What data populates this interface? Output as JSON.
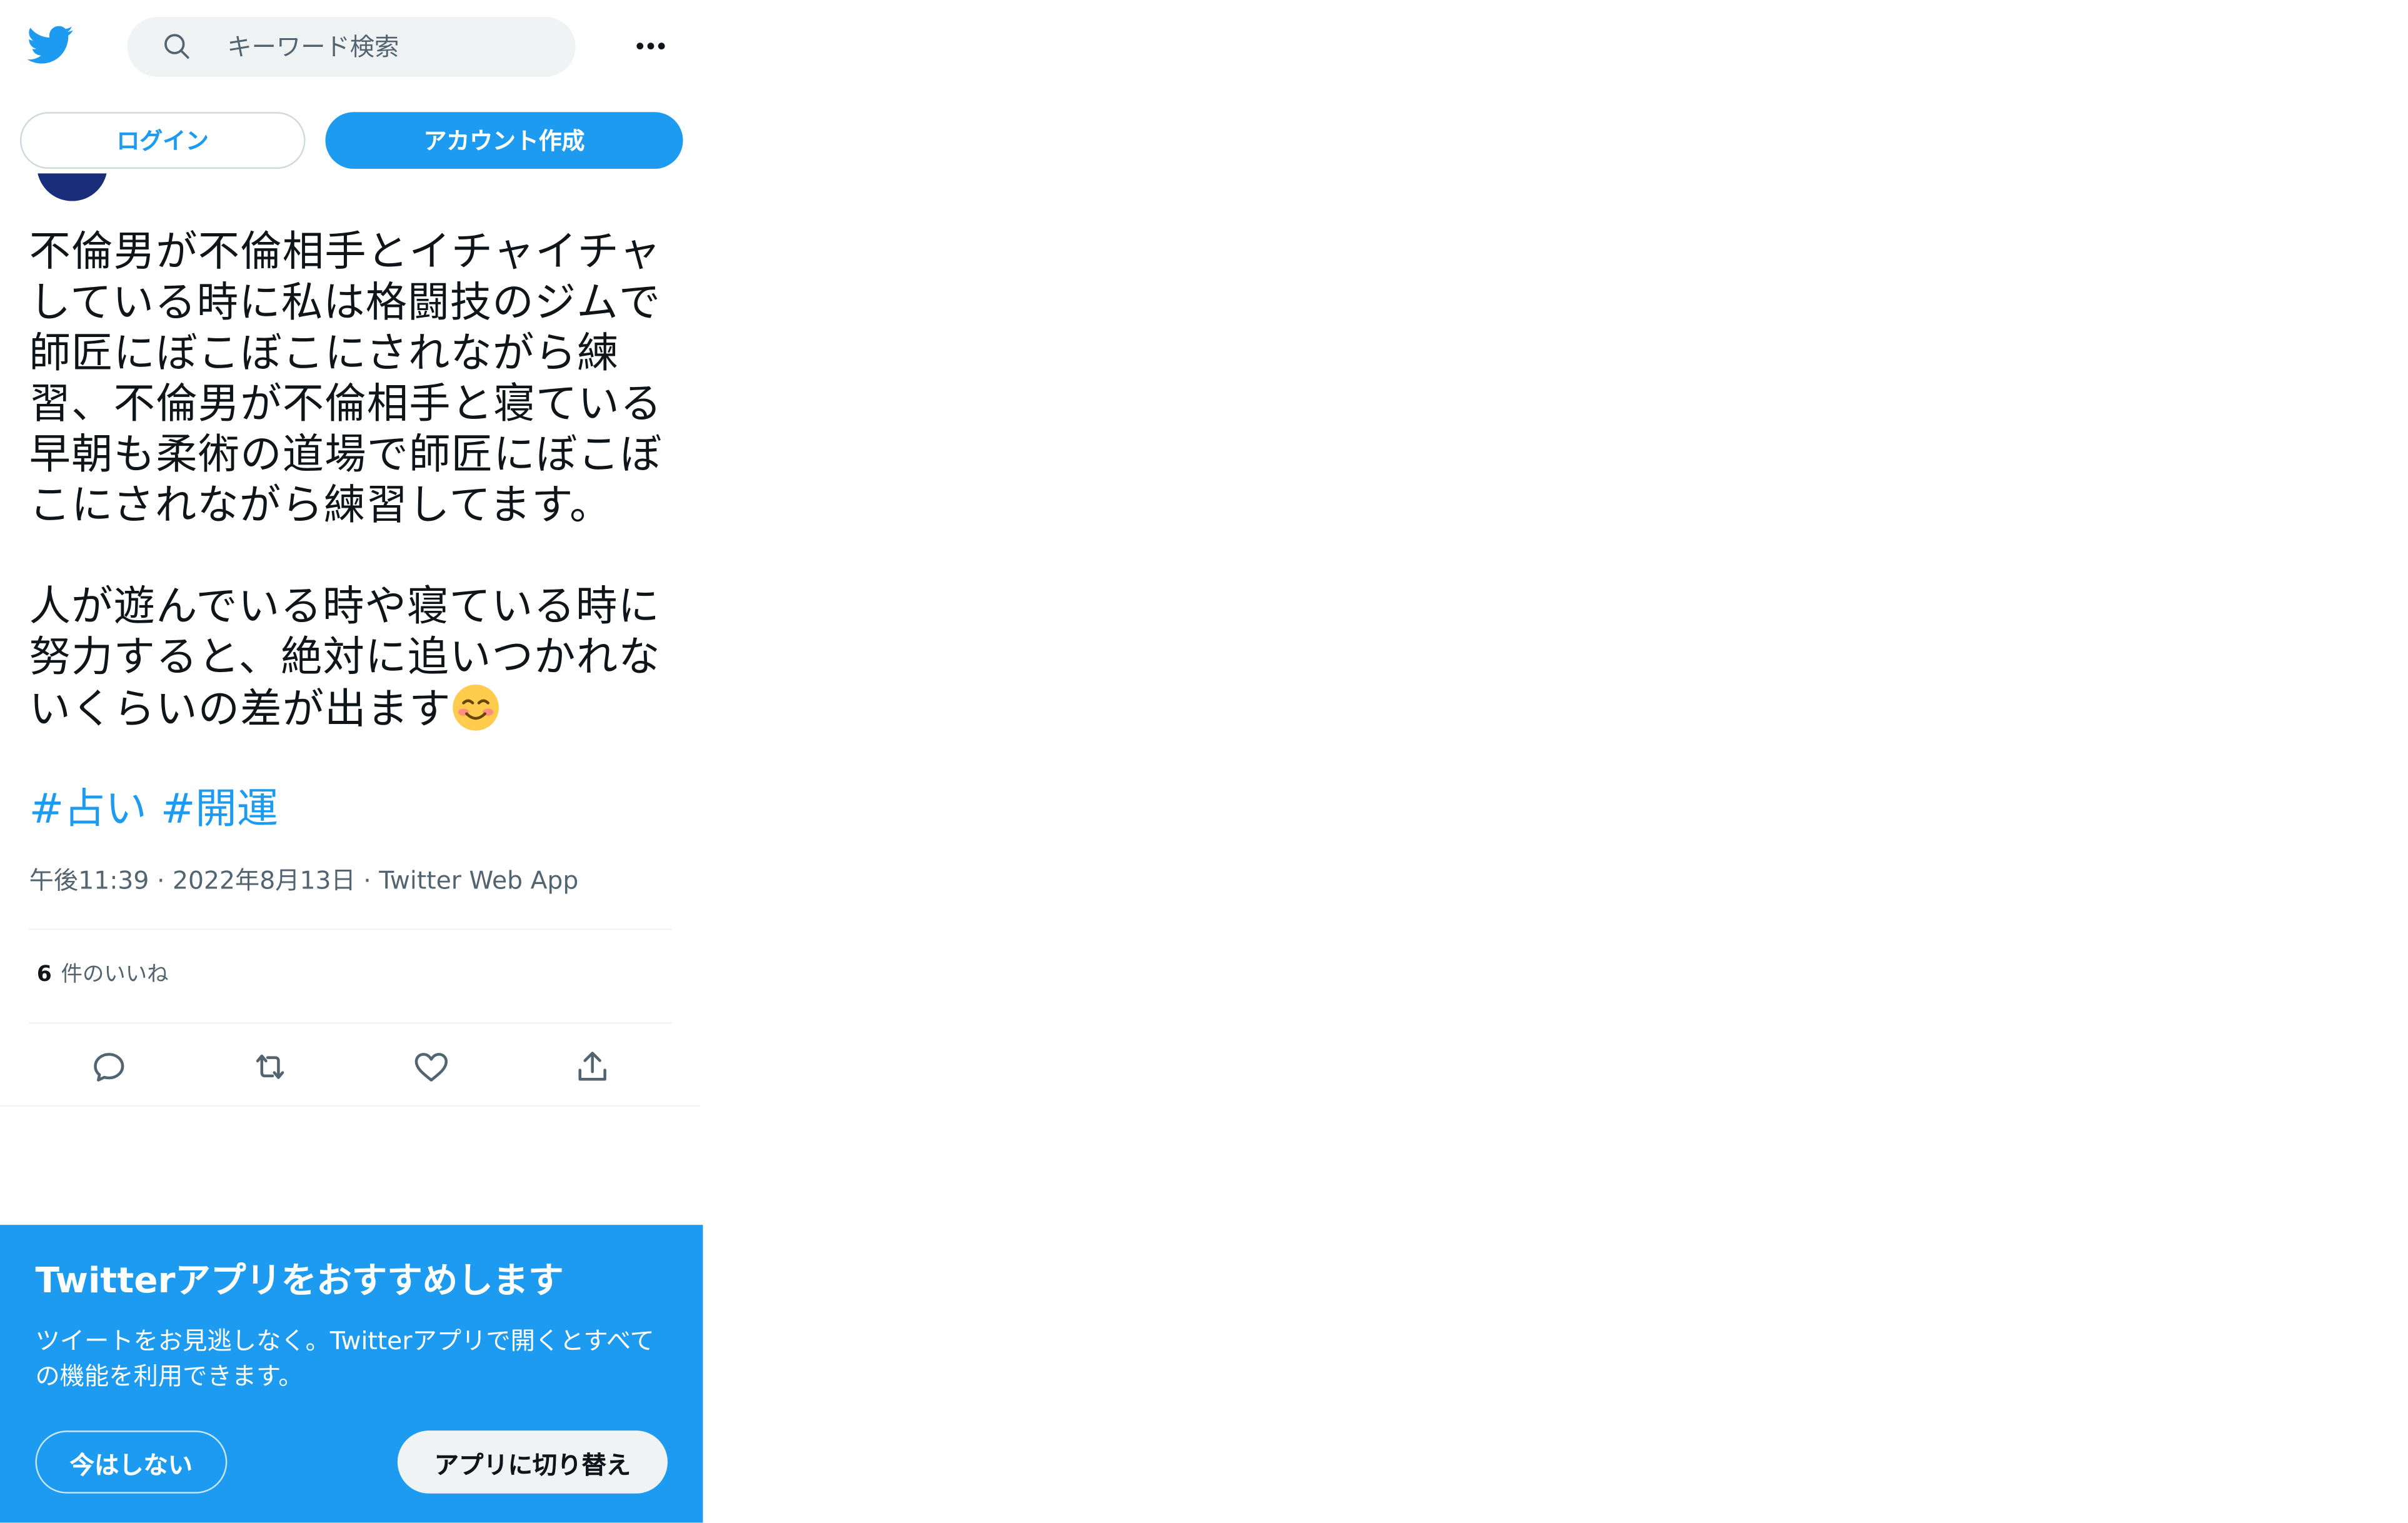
{
  "header": {
    "search_placeholder": "キーワード検索",
    "icons": [
      "twitter-bird-icon",
      "search-icon",
      "more-icon"
    ]
  },
  "auth": {
    "login_label": "ログイン",
    "signup_label": "アカウント作成"
  },
  "tweet": {
    "text": "不倫男が不倫相手とイチャイチャしている時に私は格闘技のジムで師匠にぼこぼこにされながら練習、不倫男が不倫相手と寝ている早朝も柔術の道場で師匠にぼこぼこにされながら練習してます。\n\n人が遊んでいる時や寝ている時に努力すると、絶対に追いつかれないくらいの差が出ます",
    "emoji": "smiling-face-emoji",
    "hashtags": [
      "#占い",
      "#開運"
    ],
    "time": "午後11:39",
    "date": "2022年8月13日",
    "source": "Twitter Web App",
    "separator": "·",
    "likes_count": "6",
    "likes_label": "件のいいね",
    "actions": [
      "reply-icon",
      "retweet-icon",
      "like-icon",
      "share-icon"
    ]
  },
  "banner": {
    "title": "Twitterアプリをおすすめします",
    "description": "ツイートをお見逃しなく。Twitterアプリで開くとすべての機能を利用できます。",
    "dismiss_label": "今はしない",
    "switch_label": "アプリに切り替え"
  },
  "colors": {
    "accent": "#1d9bf0",
    "text": "#0f1419",
    "muted": "#536471",
    "search_bg": "#eff3f4"
  }
}
